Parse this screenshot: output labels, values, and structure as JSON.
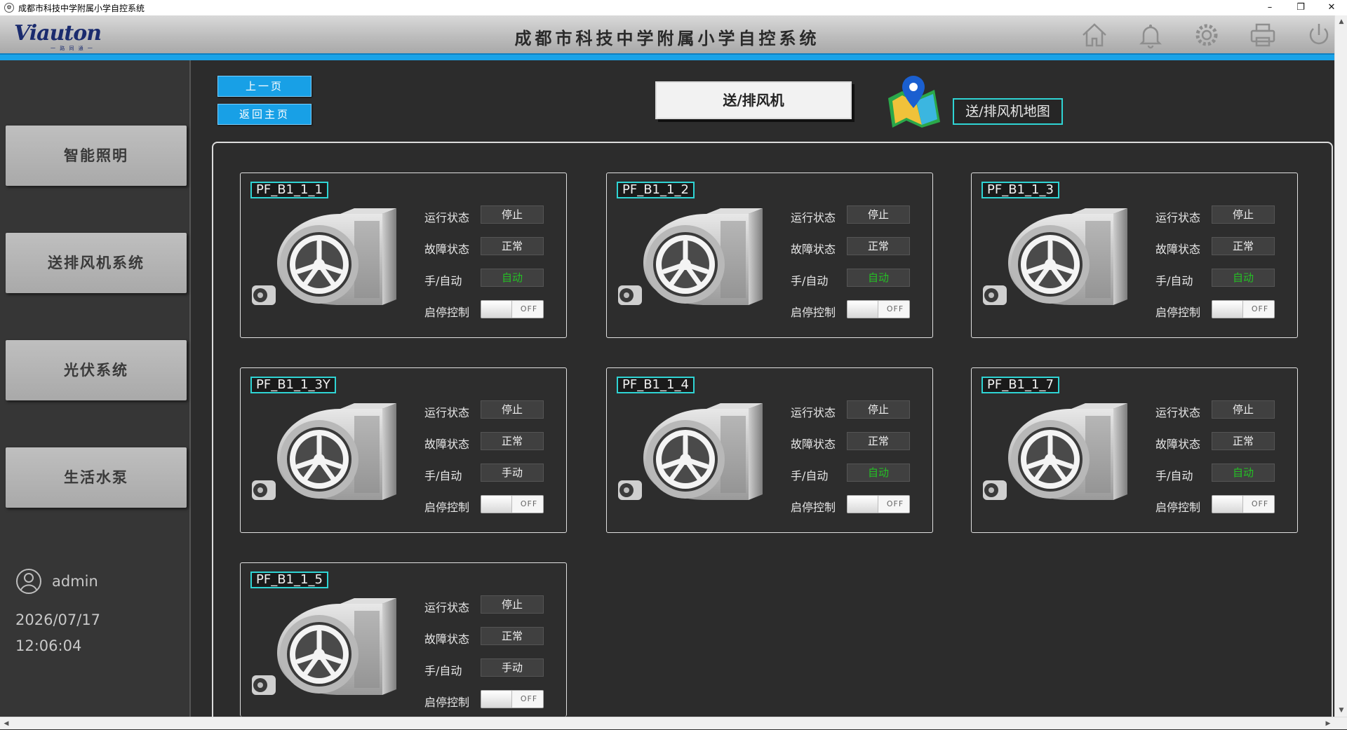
{
  "window": {
    "title": "成都市科技中学附属小学自控系统",
    "controls": [
      "–",
      "❐",
      "✕"
    ]
  },
  "header": {
    "logo": "Viauton",
    "logo_sub": "一 路 同 通 一",
    "title": "成都市科技中学附属小学自控系统",
    "icons": [
      "home-icon",
      "bell-icon",
      "gear-icon",
      "printer-icon",
      "power-icon"
    ],
    "accent_color": "#1aa3e8"
  },
  "sidebar": {
    "items": [
      {
        "label": "智能照明"
      },
      {
        "label": "送排风机系统"
      },
      {
        "label": "光伏系统"
      },
      {
        "label": "生活水泵"
      }
    ],
    "user": "admin",
    "date": "2026/07/17",
    "time": "12:06:04"
  },
  "toolbar": {
    "prev_label": "上一页",
    "home_label": "返回主页",
    "page_title": "送/排风机",
    "map_label": "送/排风机地图"
  },
  "labels": {
    "run": "运行状态",
    "fault": "故障状态",
    "mode": "手/自动",
    "control": "启停控制"
  },
  "fans": [
    {
      "name": "PF_B1_1_1",
      "run": "停止",
      "fault": "正常",
      "mode": "自动",
      "control": "OFF"
    },
    {
      "name": "PF_B1_1_2",
      "run": "停止",
      "fault": "正常",
      "mode": "自动",
      "control": "OFF"
    },
    {
      "name": "PF_B1_1_3",
      "run": "停止",
      "fault": "正常",
      "mode": "自动",
      "control": "OFF"
    },
    {
      "name": "PF_B1_1_3Y",
      "run": "停止",
      "fault": "正常",
      "mode": "手动",
      "control": "OFF"
    },
    {
      "name": "PF_B1_1_4",
      "run": "停止",
      "fault": "正常",
      "mode": "自动",
      "control": "OFF"
    },
    {
      "name": "PF_B1_1_7",
      "run": "停止",
      "fault": "正常",
      "mode": "自动",
      "control": "OFF"
    },
    {
      "name": "PF_B1_1_5",
      "run": "停止",
      "fault": "正常",
      "mode": "手动",
      "control": "OFF"
    }
  ],
  "colors": {
    "auto_text": "#24c024",
    "tag_border": "#2fd4d4"
  }
}
